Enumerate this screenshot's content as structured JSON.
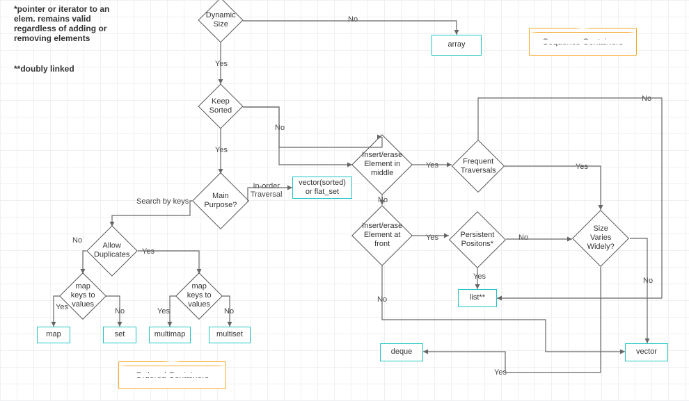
{
  "notes": {
    "note1": "*pointer or iterator to an\nelem. remains valid\nregardless of adding or\nremoving elements",
    "note2": "**doubly linked"
  },
  "banners": {
    "sequence": "Sequence Containers",
    "ordered": "Ordered Containers"
  },
  "decisions": {
    "dynamic_size": "Dynamic\nSize",
    "keep_sorted": "Keep\nSorted",
    "main_purpose": "Main Purpose?",
    "allow_dup": "Allow\nDuplicates",
    "map_kv_left": "map keys to\nvalues",
    "map_kv_right": "map keys to\nvalues",
    "insert_mid": "Insert/erase\nElement\nin middle",
    "insert_front": "Insert/erase\nElement at\nfront",
    "freq_trav": "Frequent\nTraversals",
    "persist": "Persistent\nPositons*",
    "size_varies": "Size\nVaries\nWidely?"
  },
  "terminals": {
    "array": "array",
    "vector_sorted": "vector(sorted)\nor flat_set",
    "map": "map",
    "set": "set",
    "multimap": "multimap",
    "multiset": "multiset",
    "list": "list**",
    "deque": "deque",
    "vector": "vector"
  },
  "labels": {
    "yes": "Yes",
    "no": "No",
    "search_by_keys": "Search by keys",
    "in_order_traversal": "In-order\nTraversal"
  }
}
